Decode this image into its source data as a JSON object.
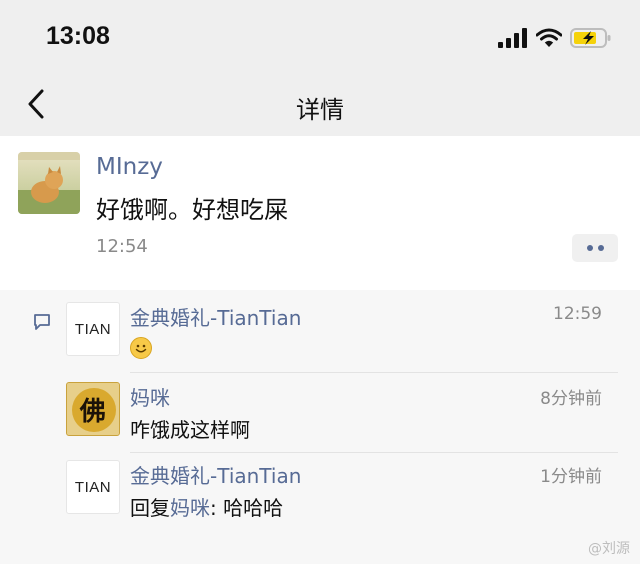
{
  "status_bar": {
    "time": "13:08"
  },
  "navbar": {
    "title": "详情"
  },
  "post": {
    "author": "MInzy",
    "text": "好饿啊。好想吃屎",
    "time": "12:54"
  },
  "comments": [
    {
      "avatar_text": "TIAN",
      "name": "金典婚礼-TianTian",
      "time": "12:59",
      "text": "",
      "emoji": "smile-emoji"
    },
    {
      "avatar_text": "佛",
      "name": "妈咪",
      "time": "8分钟前",
      "text": "咋饿成这样啊"
    },
    {
      "avatar_text": "TIAN",
      "name": "金典婚礼-TianTian",
      "time": "1分钟前",
      "reply_prefix": "回复",
      "reply_to": "妈咪",
      "reply_sep": ": ",
      "text": "哈哈哈"
    }
  ],
  "watermark": "@刘源",
  "colors": {
    "link": "#576b95",
    "header_bg": "#efefef",
    "comment_bg": "#f7f7f7"
  }
}
